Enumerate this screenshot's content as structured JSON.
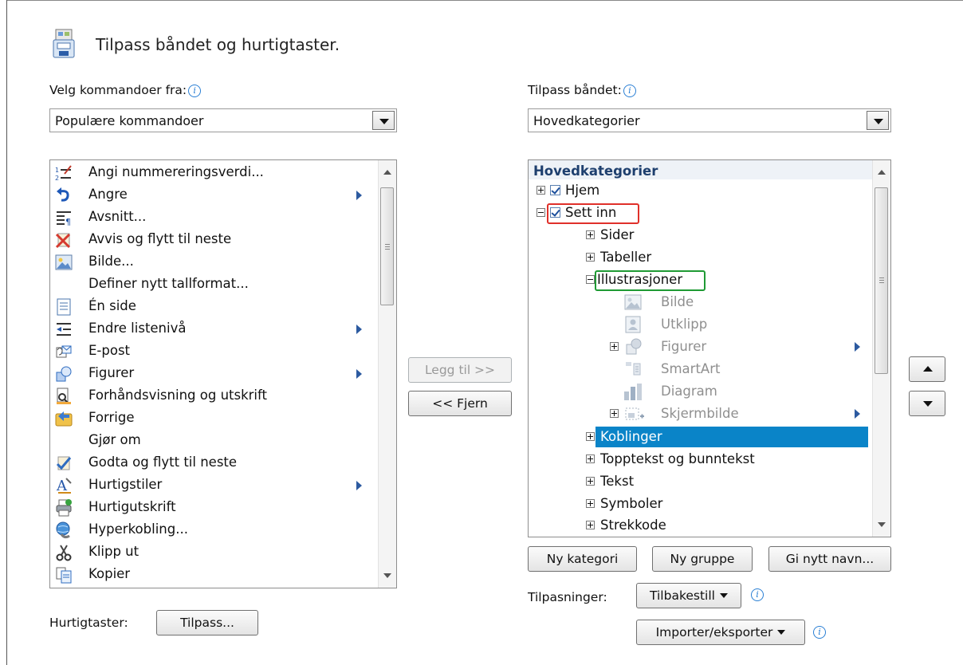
{
  "header": {
    "title": "Tilpass båndet og hurtigtaster."
  },
  "left": {
    "label": "Velg kommandoer fra:",
    "combo_value": "Populære kommandoer",
    "items": [
      {
        "label": "Angi nummereringsverdi...",
        "icon": "numbering-value-icon",
        "submenu": false
      },
      {
        "label": "Angre",
        "icon": "undo-icon",
        "submenu": true
      },
      {
        "label": "Avsnitt...",
        "icon": "paragraph-icon",
        "submenu": false
      },
      {
        "label": "Avvis og flytt til neste",
        "icon": "reject-change-icon",
        "submenu": false
      },
      {
        "label": "Bilde...",
        "icon": "picture-icon",
        "submenu": false
      },
      {
        "label": "Definer nytt tallformat...",
        "icon": "",
        "submenu": false
      },
      {
        "label": "Én side",
        "icon": "one-page-icon",
        "submenu": false
      },
      {
        "label": "Endre listenivå",
        "icon": "list-level-icon",
        "submenu": true
      },
      {
        "label": "E-post",
        "icon": "email-icon",
        "submenu": false
      },
      {
        "label": "Figurer",
        "icon": "shapes-icon",
        "submenu": true
      },
      {
        "label": "Forhåndsvisning og utskrift",
        "icon": "print-preview-icon",
        "submenu": false
      },
      {
        "label": "Forrige",
        "icon": "previous-icon",
        "submenu": false
      },
      {
        "label": "Gjør om",
        "icon": "",
        "submenu": false
      },
      {
        "label": "Godta og flytt til neste",
        "icon": "accept-change-icon",
        "submenu": false
      },
      {
        "label": "Hurtigstiler",
        "icon": "quick-styles-icon",
        "submenu": true
      },
      {
        "label": "Hurtigutskrift",
        "icon": "quick-print-icon",
        "submenu": false
      },
      {
        "label": "Hyperkobling...",
        "icon": "hyperlink-icon",
        "submenu": false
      },
      {
        "label": "Klipp ut",
        "icon": "cut-icon",
        "submenu": false
      },
      {
        "label": "Kopier",
        "icon": "copy-icon",
        "submenu": false
      }
    ]
  },
  "right": {
    "label": "Tilpass båndet:",
    "combo_value": "Hovedkategorier",
    "tree_header": "Hovedkategorier",
    "tree": {
      "hjem": "Hjem",
      "sett_inn": "Sett inn",
      "sider": "Sider",
      "tabeller": "Tabeller",
      "illustrasjoner": "Illustrasjoner",
      "bilde": "Bilde",
      "utklipp": "Utklipp",
      "figurer": "Figurer",
      "smartart": "SmartArt",
      "diagram": "Diagram",
      "skjermbilde": "Skjermbilde",
      "koblinger": "Koblinger",
      "topptekst": "Topptekst og bunntekst",
      "tekst": "Tekst",
      "symboler": "Symboler",
      "strekkode": "Strekkode"
    }
  },
  "middle": {
    "add_label": "Legg til >>",
    "remove_label": "<< Fjern"
  },
  "bottom": {
    "new_category": "Ny kategori",
    "new_group": "Ny gruppe",
    "rename": "Gi nytt navn...",
    "customizations_label": "Tilpasninger:",
    "reset": "Tilbakestill",
    "import_export": "Importer/eksporter",
    "shortcuts_label": "Hurtigtaster:",
    "customize": "Tilpass..."
  },
  "colors": {
    "selection": "#0a84c8",
    "highlight_red": "#e0302a",
    "highlight_green": "#1f9a34"
  }
}
